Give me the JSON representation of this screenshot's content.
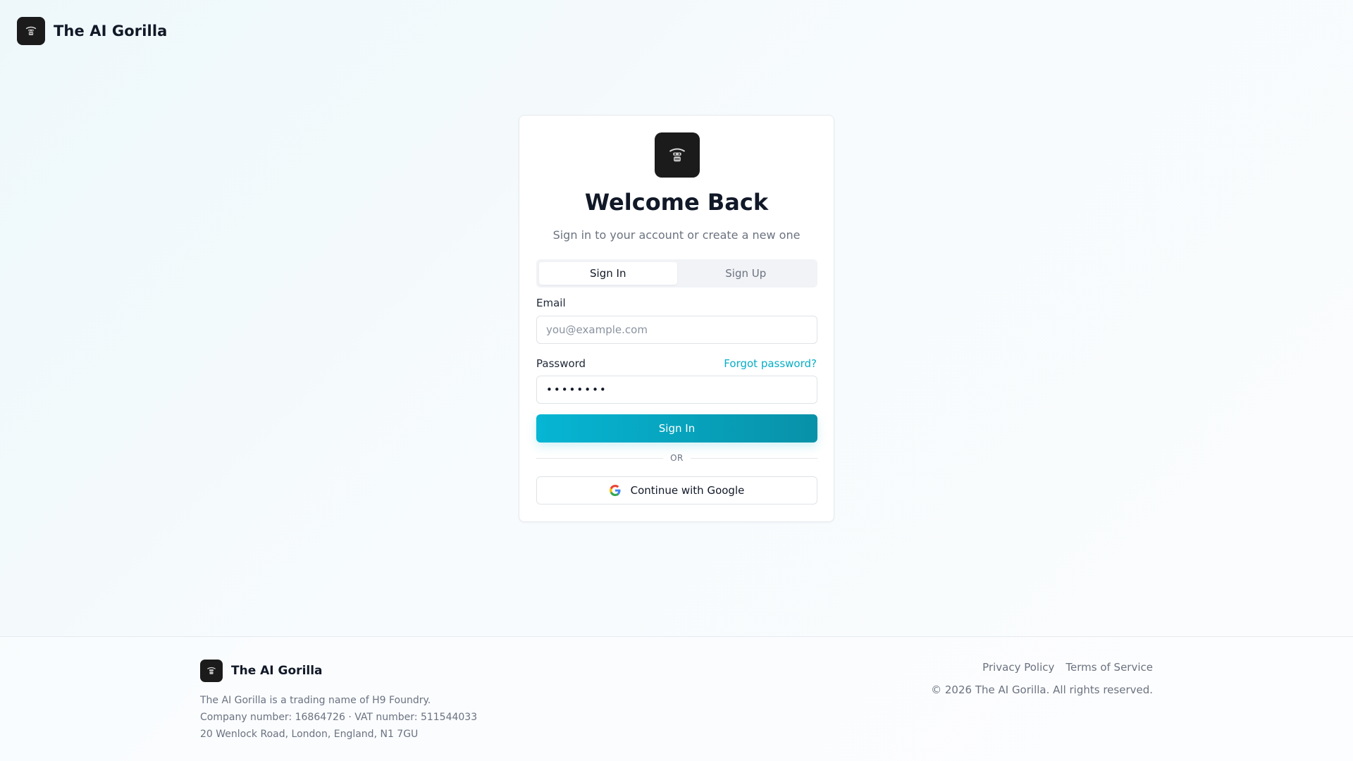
{
  "header": {
    "brand_name": "The AI Gorilla",
    "logo_icon": "gorilla-icon"
  },
  "auth_card": {
    "logo_icon": "gorilla-icon",
    "title": "Welcome Back",
    "subtitle": "Sign in to your account or create a new one",
    "tabs": [
      {
        "label": "Sign In",
        "active": true
      },
      {
        "label": "Sign Up",
        "active": false
      }
    ],
    "email": {
      "label": "Email",
      "placeholder": "you@example.com",
      "value": ""
    },
    "password": {
      "label": "Password",
      "value": "••••••••",
      "forgot_label": "Forgot password?"
    },
    "submit_label": "Sign In",
    "divider_label": "OR",
    "google_label": "Continue with Google",
    "google_icon": "google-icon"
  },
  "footer": {
    "brand_name": "The AI Gorilla",
    "lines": [
      "The AI Gorilla is a trading name of H9 Foundry.",
      "Company number: 16864726 · VAT number: 511544033",
      "20 Wenlock Road, London, England, N1 7GU"
    ],
    "links": [
      {
        "label": "Privacy Policy"
      },
      {
        "label": "Terms of Service"
      }
    ],
    "copyright": "© 2026 The AI Gorilla. All rights reserved."
  },
  "colors": {
    "accent": "#06b6d4",
    "accent_dark": "#0891a8",
    "logo_bg": "#1b1b1b",
    "link": "#06aec6"
  }
}
